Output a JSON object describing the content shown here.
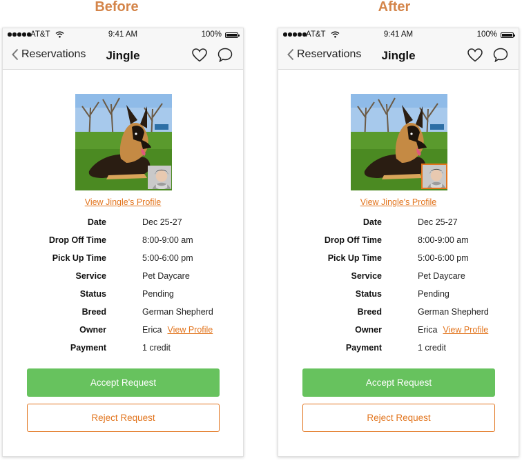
{
  "panels": {
    "before": {
      "heading": "Before",
      "status": {
        "carrier": "AT&T",
        "time": "9:41 AM",
        "battery": "100%"
      },
      "nav": {
        "back_label": "Reservations",
        "title": "Jingle"
      },
      "profile_link": "View Jingle's Profile",
      "details": [
        {
          "label": "Date",
          "value": "Dec 25-27"
        },
        {
          "label": "Drop Off Time",
          "value": "8:00-9:00 am"
        },
        {
          "label": "Pick Up Time",
          "value": "5:00-6:00 pm"
        },
        {
          "label": "Service",
          "value": "Pet Daycare"
        },
        {
          "label": "Status",
          "value": "Pending"
        },
        {
          "label": "Breed",
          "value": "German Shepherd"
        },
        {
          "label": "Owner",
          "value": "Erica",
          "link": "View Profile"
        },
        {
          "label": "Payment",
          "value": "1 credit"
        }
      ],
      "accept_label": "Accept Request",
      "reject_label": "Reject Request"
    },
    "after": {
      "heading": "After",
      "status": {
        "carrier": "AT&T",
        "time": "9:41 AM",
        "battery": "100%"
      },
      "nav": {
        "back_label": "Reservations",
        "title": "Jingle"
      },
      "profile_link": "View Jingle's Profile",
      "details": [
        {
          "label": "Date",
          "value": "Dec 25-27"
        },
        {
          "label": "Drop Off Time",
          "value": "8:00-9:00 am"
        },
        {
          "label": "Pick Up Time",
          "value": "5:00-6:00 pm"
        },
        {
          "label": "Service",
          "value": "Pet Daycare"
        },
        {
          "label": "Status",
          "value": "Pending"
        },
        {
          "label": "Breed",
          "value": "German Shepherd"
        },
        {
          "label": "Owner",
          "value": "Erica",
          "link": "View Profile"
        },
        {
          "label": "Payment",
          "value": "1 credit"
        }
      ],
      "accept_label": "Accept Request",
      "reject_label": "Reject Request"
    }
  },
  "colors": {
    "accent_orange": "#e2741d",
    "heading_orange": "#d4854a",
    "accept_green": "#67c25e"
  }
}
